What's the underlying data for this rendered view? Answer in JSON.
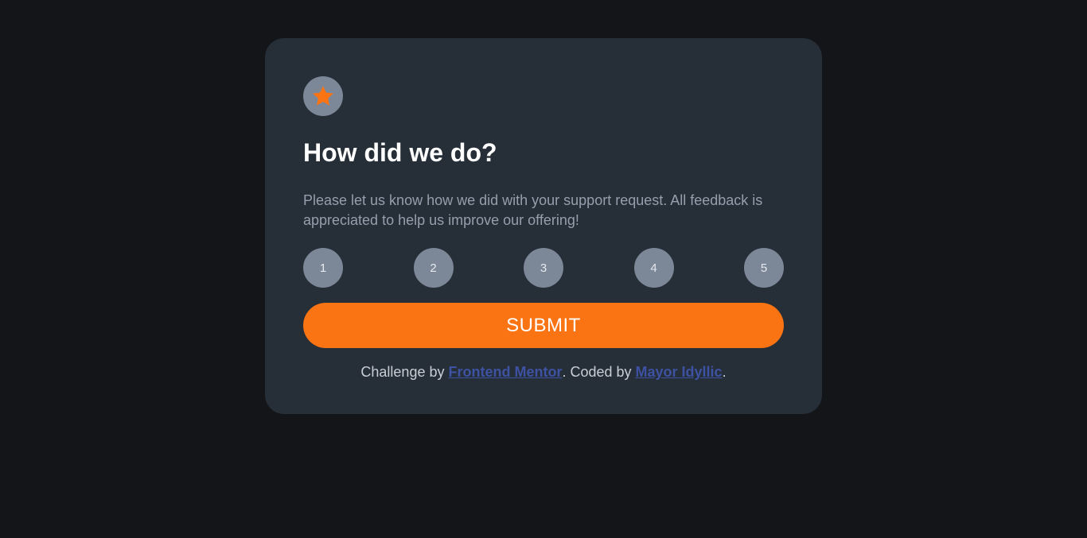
{
  "card": {
    "icon": "star-icon",
    "title": "How did we do?",
    "description": "Please let us know how we did with your support request. All feedback is appreciated to help us improve our offering!",
    "ratings": [
      "1",
      "2",
      "3",
      "4",
      "5"
    ],
    "submit_label": "SUBMIT"
  },
  "attribution": {
    "prefix": "Challenge by ",
    "link1": "Frontend Mentor",
    "middle": ". Coded by ",
    "link2": "Mayor Idyllic",
    "suffix": "."
  },
  "colors": {
    "page_bg": "#131518",
    "card_bg": "#262e38",
    "accent": "#fb7413",
    "rating_bg": "#7c8798",
    "link": "#3e52a3"
  }
}
